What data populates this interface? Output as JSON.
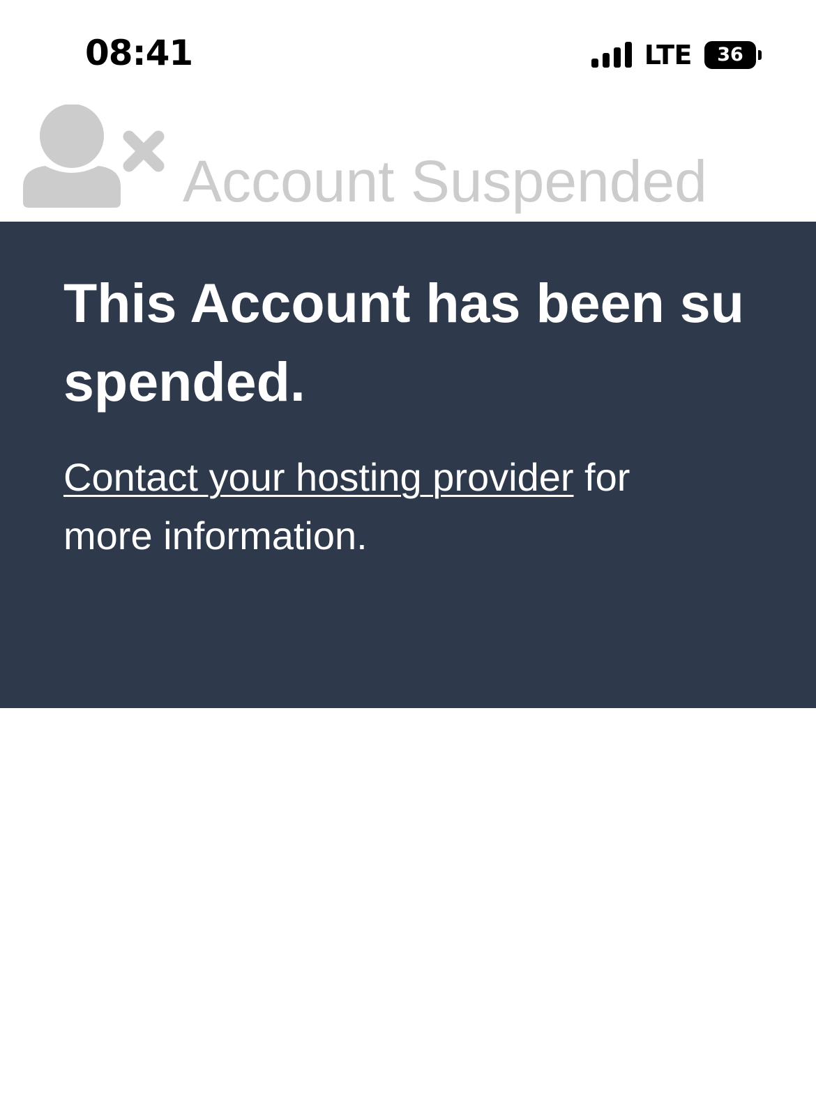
{
  "status_bar": {
    "time": "08:41",
    "network": "LTE",
    "battery_level": "36",
    "signal_icon": "cellular-signal-icon",
    "signal_bars_filled": 4
  },
  "header": {
    "icon": "user-x-icon",
    "title": "Account Suspended",
    "title_color": "#cccccc"
  },
  "message": {
    "heading": "This Account has been suspended.",
    "link_text": "Contact your hosting provider",
    "body_suffix": " for more information.",
    "panel_color": "#2e3a4b"
  }
}
